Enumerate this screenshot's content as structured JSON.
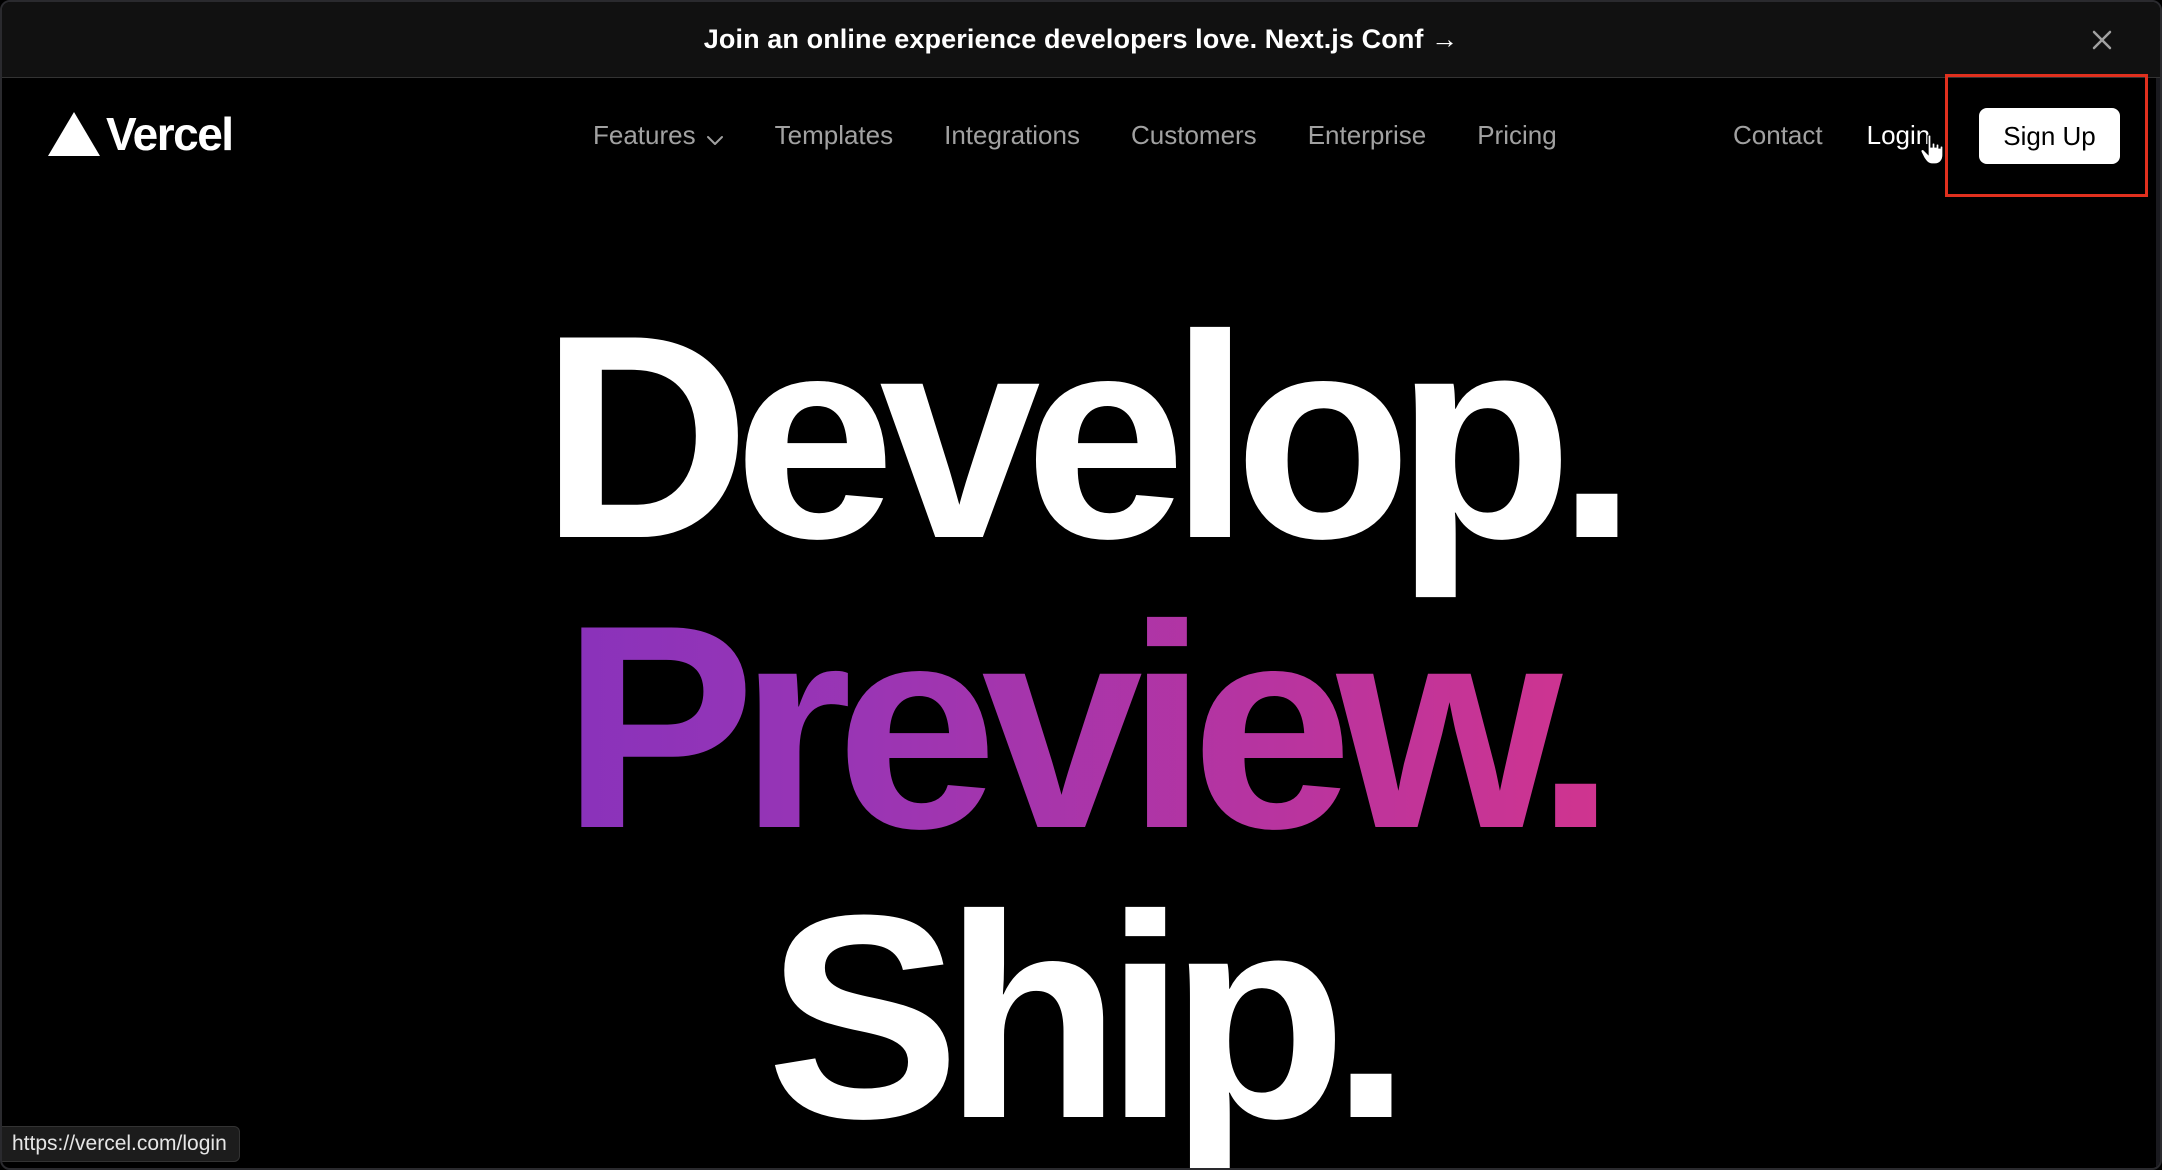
{
  "banner": {
    "text": "Join an online experience developers love. Next.js Conf →",
    "close_icon": "close-icon"
  },
  "nav": {
    "logo_text": "Vercel",
    "logo_icon": "triangle-logo-icon",
    "links": [
      {
        "label": "Features",
        "has_dropdown": true
      },
      {
        "label": "Templates"
      },
      {
        "label": "Integrations"
      },
      {
        "label": "Customers"
      },
      {
        "label": "Enterprise"
      },
      {
        "label": "Pricing"
      }
    ],
    "contact": "Contact",
    "login": "Login",
    "signup": "Sign Up"
  },
  "hero": {
    "line1": "Develop.",
    "line2": "Preview.",
    "line3": "Ship."
  },
  "status_bar": {
    "url": "https://vercel.com/login"
  },
  "colors": {
    "background": "#000000",
    "banner_bg": "#111111",
    "nav_link": "#a1a1a1",
    "highlight": "#e0301e",
    "gradient_start": "#6a2dc8",
    "gradient_end": "#ee2f78"
  }
}
